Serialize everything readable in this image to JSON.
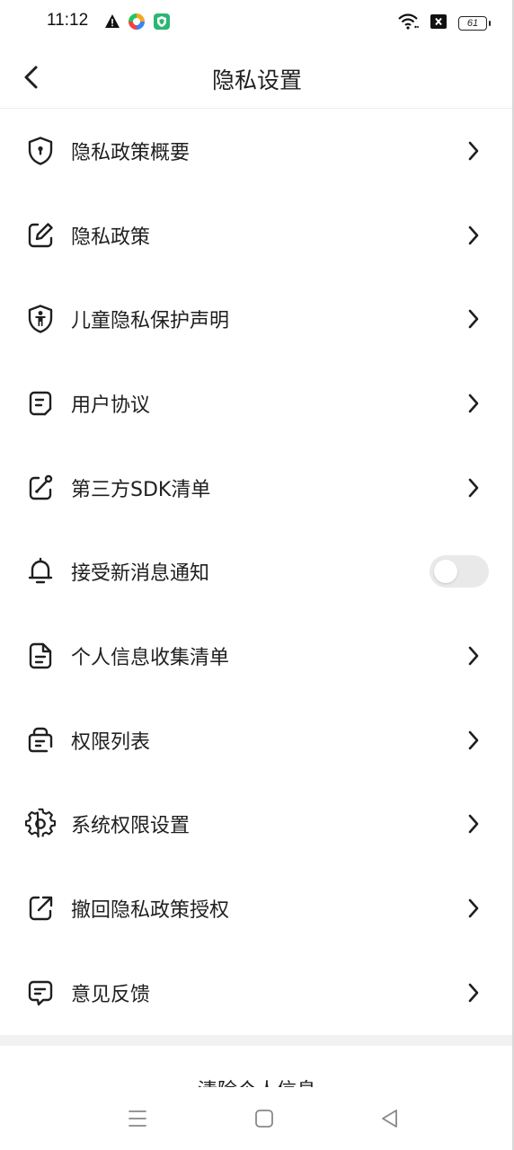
{
  "status_bar": {
    "time": "11:12",
    "battery_level": "61",
    "icons": [
      "warning-icon",
      "app-icon",
      "shield-app-icon",
      "wifi-icon",
      "close-box-icon",
      "battery-icon"
    ]
  },
  "header": {
    "title": "隐私设置"
  },
  "menu": {
    "items": [
      {
        "label": "隐私政策概要",
        "icon": "shield-lock-icon",
        "control": "chevron"
      },
      {
        "label": "隐私政策",
        "icon": "edit-icon",
        "control": "chevron"
      },
      {
        "label": "儿童隐私保护声明",
        "icon": "child-shield-icon",
        "control": "chevron"
      },
      {
        "label": "用户协议",
        "icon": "document-icon",
        "control": "chevron"
      },
      {
        "label": "第三方SDK清单",
        "icon": "link-box-icon",
        "control": "chevron"
      },
      {
        "label": "接受新消息通知",
        "icon": "bell-icon",
        "control": "toggle",
        "enabled": false
      },
      {
        "label": "个人信息收集清单",
        "icon": "file-list-icon",
        "control": "chevron"
      },
      {
        "label": "权限列表",
        "icon": "bag-icon",
        "control": "chevron"
      },
      {
        "label": "系统权限设置",
        "icon": "gear-icon",
        "control": "chevron"
      },
      {
        "label": "撤回隐私政策授权",
        "icon": "share-box-icon",
        "control": "chevron"
      },
      {
        "label": "意见反馈",
        "icon": "feedback-icon",
        "control": "chevron"
      }
    ]
  },
  "footer": {
    "clear_label": "清除个人信息"
  },
  "colors": {
    "text": "#1f1f1f",
    "toggle_off": "#e9e9e9",
    "divider": "#f2f2f4"
  }
}
